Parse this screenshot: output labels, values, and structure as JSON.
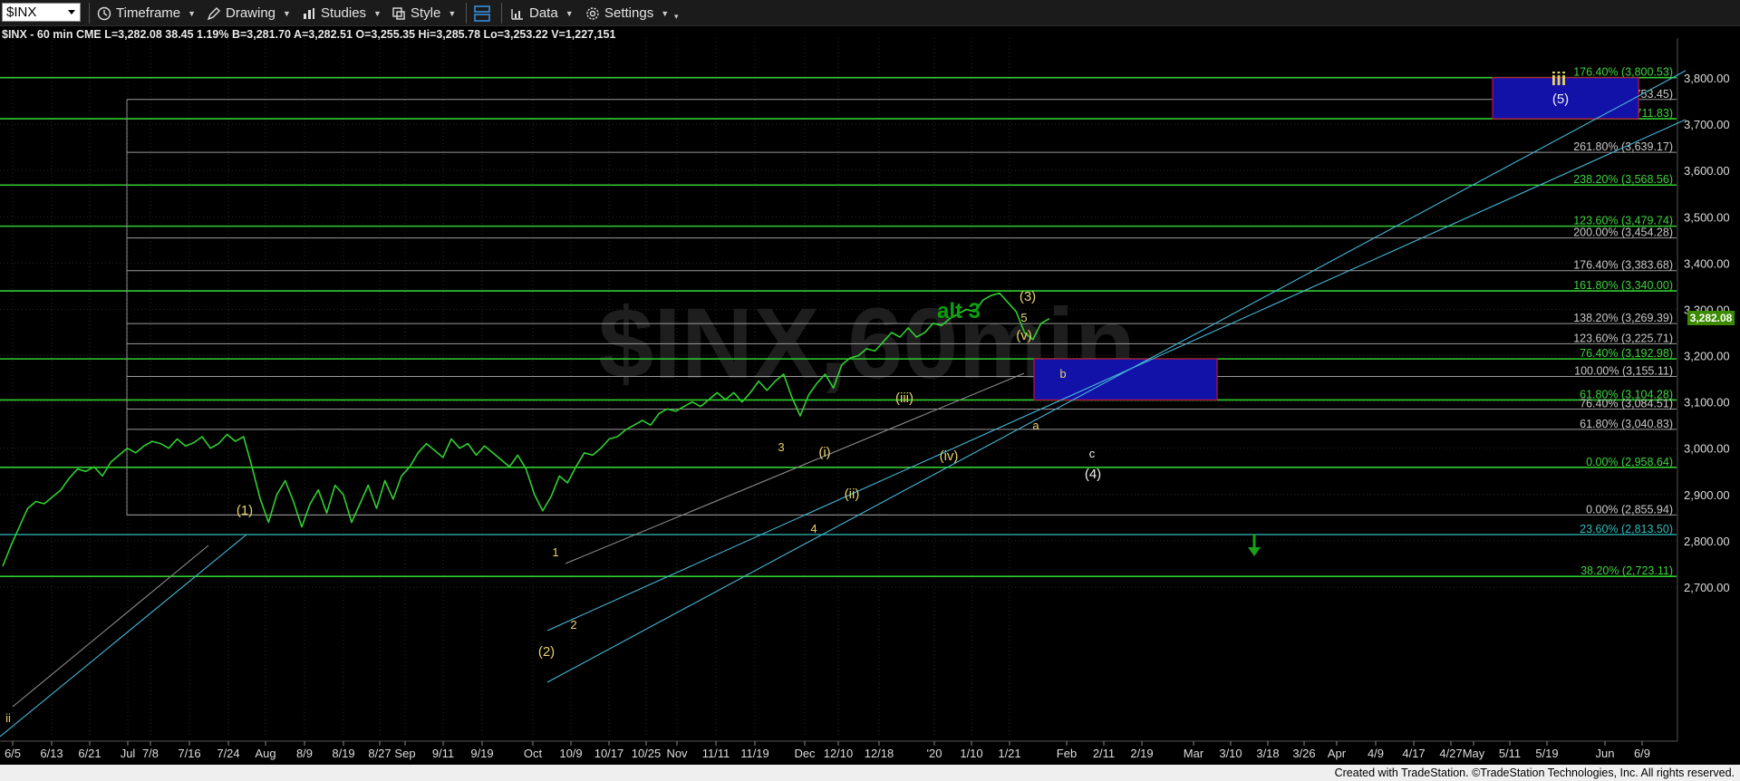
{
  "toolbar": {
    "symbol": "$INX",
    "timeframe": "Timeframe",
    "drawing": "Drawing",
    "studies": "Studies",
    "style": "Style",
    "data": "Data",
    "settings": "Settings"
  },
  "quote_line": "$INX - 60 min  CME  L=3,282.08  38.45  1.19%  B=3,281.70  A=3,282.51  O=3,255.35  Hi=3,285.78  Lo=3,253.22  V=1,227,151",
  "last_price_tag": "3,282.08",
  "watermark": "$INX,60min",
  "footer": "Created with TradeStation. ©TradeStation Technologies, Inc. All rights reserved.",
  "colors": {
    "price": "#2fd02f",
    "channel": "#47b6d6",
    "fib_green": "#33cc33",
    "fib_gray": "#9a9a9a",
    "wave_label": "#e7d36a",
    "target_box": "#1212a8",
    "target_border": "#c0143c"
  },
  "chart_data": {
    "type": "line",
    "title": "",
    "xlabel": "",
    "ylabel": "",
    "ylim": [
      2660,
      3870
    ],
    "grid": true,
    "y_ticks": [
      "2,700.00",
      "2,800.00",
      "2,900.00",
      "3,000.00",
      "3,100.00",
      "3,200.00",
      "3,300.00",
      "3,400.00",
      "3,500.00",
      "3,600.00",
      "3,700.00",
      "3,800.00"
    ],
    "x_ticks": [
      "6/5",
      "6/13",
      "6/21",
      "Jul",
      "7/8",
      "7/16",
      "7/24",
      "Aug",
      "8/9",
      "8/19",
      "8/27",
      "Sep",
      "9/11",
      "9/19",
      "Oct",
      "10/9",
      "10/17",
      "10/25",
      "Nov",
      "11/11",
      "11/19",
      "Dec",
      "12/10",
      "12/18",
      "'20",
      "1/10",
      "1/21",
      "Feb",
      "2/11",
      "2/19",
      "Mar",
      "3/10",
      "3/18",
      "3/26",
      "Apr",
      "4/9",
      "4/17",
      "4/27",
      "May",
      "5/11",
      "5/19",
      "Jun",
      "6/9"
    ],
    "series": [
      {
        "values": [
          2745,
          2790,
          2830,
          2870,
          2885,
          2880,
          2895,
          2910,
          2935,
          2955,
          2950,
          2960,
          2940,
          2970,
          2985,
          3000,
          2990,
          3005,
          3015,
          3010,
          3000,
          3020,
          3005,
          3012,
          3025,
          3000,
          3010,
          3030,
          3015,
          3025,
          2960,
          2890,
          2840,
          2900,
          2930,
          2885,
          2830,
          2880,
          2910,
          2860,
          2920,
          2900,
          2840,
          2880,
          2920,
          2870,
          2930,
          2890,
          2940,
          2960,
          2990,
          3010,
          2995,
          2980,
          3020,
          3000,
          3010,
          2985,
          3005,
          2990,
          2975,
          2960,
          2985,
          2955,
          2900,
          2865,
          2895,
          2940,
          2925,
          2960,
          2990,
          2985,
          3000,
          3020,
          3025,
          3040,
          3050,
          3060,
          3050,
          3075,
          3085,
          3080,
          3090,
          3100,
          3090,
          3105,
          3120,
          3105,
          3120,
          3100,
          3120,
          3145,
          3125,
          3145,
          3160,
          3110,
          3070,
          3115,
          3140,
          3160,
          3130,
          3180,
          3195,
          3200,
          3215,
          3210,
          3230,
          3250,
          3240,
          3260,
          3240,
          3250,
          3270,
          3265,
          3280,
          3290,
          3300,
          3295,
          3320,
          3330,
          3335,
          3315,
          3295,
          3250,
          3235,
          3270,
          3280
        ]
      }
    ],
    "fib_levels": [
      {
        "label": "176.40% (3,800.53)",
        "value": 3800.53,
        "style": "green"
      },
      {
        "label": "300.00% (3,753.45)",
        "value": 3753.45,
        "style": "gray"
      },
      {
        "label": "161.80% (3,711.83)",
        "value": 3711.83,
        "style": "green"
      },
      {
        "label": "261.80% (3,639.17)",
        "value": 3639.17,
        "style": "gray"
      },
      {
        "label": "238.20% (3,568.56)",
        "value": 3568.56,
        "style": "green"
      },
      {
        "label": "123.60% (3,479.74)",
        "value": 3479.74,
        "style": "green"
      },
      {
        "label": "200.00% (3,454.28)",
        "value": 3454.28,
        "style": "gray"
      },
      {
        "label": "176.40% (3,383.68)",
        "value": 3383.68,
        "style": "gray"
      },
      {
        "label": "161.80% (3,340.00)",
        "value": 3340.0,
        "style": "green"
      },
      {
        "label": "138.20% (3,269.39)",
        "value": 3269.39,
        "style": "gray"
      },
      {
        "label": "123.60% (3,225.71)",
        "value": 3225.71,
        "style": "gray"
      },
      {
        "label": "76.40% (3,192.98)",
        "value": 3192.98,
        "style": "green"
      },
      {
        "label": "100.00% (3,155.11)",
        "value": 3155.11,
        "style": "gray"
      },
      {
        "label": "61.80% (3,104.28)",
        "value": 3104.28,
        "style": "green"
      },
      {
        "label": "76.40% (3,084.51)",
        "value": 3084.51,
        "style": "gray"
      },
      {
        "label": "61.80% (3,040.83)",
        "value": 3040.83,
        "style": "gray"
      },
      {
        "label": "0.00% (2,958.64)",
        "value": 2958.64,
        "style": "green"
      },
      {
        "label": "0.00% (2,855.94)",
        "value": 2855.94,
        "style": "gray"
      },
      {
        "label": "23.60% (2,813.50)",
        "value": 2813.5,
        "style": "teal"
      },
      {
        "label": "38.20% (2,723.11)",
        "value": 2723.11,
        "style": "green"
      }
    ],
    "wave_labels": [
      {
        "text": "(1)",
        "x": "7/24",
        "y": 3060,
        "color": "yellow"
      },
      {
        "text": "(2)",
        "x": "Oct",
        "y": 2810,
        "color": "yellow"
      },
      {
        "text": "1",
        "x": "10/9",
        "y": 2985,
        "color": "yellow"
      },
      {
        "text": "2",
        "x": "10/9",
        "y": 2860,
        "color": "yellow"
      },
      {
        "text": "3",
        "x": "Dec",
        "y": 3170,
        "color": "yellow"
      },
      {
        "text": "4",
        "x": "Dec",
        "y": 3035,
        "color": "yellow"
      },
      {
        "text": "(i)",
        "x": "Dec",
        "y": 3165,
        "color": "yellow"
      },
      {
        "text": "(ii)",
        "x": "12/10",
        "y": 3085,
        "color": "yellow"
      },
      {
        "text": "(iii)",
        "x": "12/18",
        "y": 3290,
        "color": "yellow"
      },
      {
        "text": "(iv)",
        "x": "'20",
        "y": 3175,
        "color": "yellow"
      },
      {
        "text": "(v)",
        "x": "1/21",
        "y": 3375,
        "color": "yellow"
      },
      {
        "text": "5",
        "x": "1/21",
        "y": 3405,
        "color": "yellow"
      },
      {
        "text": "(3)",
        "x": "1/21",
        "y": 3445,
        "color": "yellow"
      },
      {
        "text": "a",
        "x": "1/21",
        "y": 3215,
        "color": "yellow"
      },
      {
        "text": "b",
        "x": "1/21",
        "y": 3305,
        "color": "yellow"
      },
      {
        "text": "c",
        "x": "Feb",
        "y": 3165,
        "color": "white"
      },
      {
        "text": "(4)",
        "x": "Feb",
        "y": 3125,
        "color": "white"
      },
      {
        "text": "(5)",
        "x": "5/19",
        "y": 3790,
        "color": "white"
      },
      {
        "text": "alt 3",
        "x": "'20",
        "y": 3410,
        "color": "green"
      },
      {
        "text": "iii",
        "x": "5/19",
        "y": 3830,
        "color": "yellow"
      },
      {
        "text": "ii",
        "x": "6/5",
        "y": 2690,
        "color": "yellow"
      }
    ],
    "target_boxes": [
      {
        "label": "(4)",
        "top": 3192.98,
        "bottom": 3104.28
      },
      {
        "label": "(5)",
        "top": 3800.53,
        "bottom": 3711.83
      }
    ],
    "last_price": 3282.08
  }
}
